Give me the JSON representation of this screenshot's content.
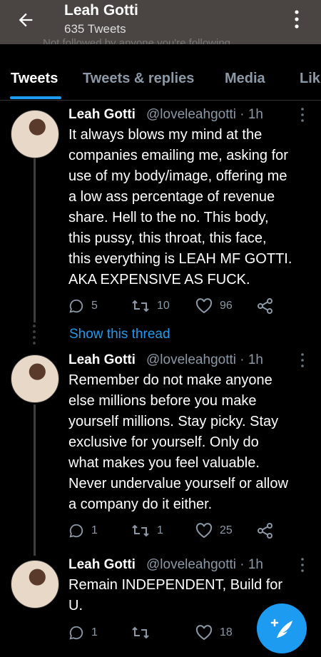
{
  "header": {
    "name": "Leah Gotti",
    "tweet_count": "635 Tweets",
    "obscured_text": "Not followed by anyone you're following"
  },
  "tabs": [
    "Tweets",
    "Tweets & replies",
    "Media",
    "Lik"
  ],
  "show_thread": "Show this thread",
  "tweets": [
    {
      "name": "Leah Gotti",
      "handle": "@loveleahgotti · 1h",
      "lines": [
        "It always blows my mind at the",
        "companies emailing me, asking for",
        "use of my body/image, offering me",
        "a low ass percentage of revenue",
        "share. Hell to the no. This body,",
        "this pussy, this throat, this face,",
        "this everything is LEAH MF GOTTI.",
        "AKA EXPENSIVE AS FUCK."
      ],
      "replies": "5",
      "retweets": "10",
      "likes": "96"
    },
    {
      "name": "Leah Gotti",
      "handle": "@loveleahgotti · 1h",
      "lines": [
        "Remember do not make anyone",
        "else millions before you make",
        "yourself millions. Stay picky. Stay",
        "exclusive for yourself.  Only do",
        "what makes you feel valuable.",
        "Never undervalue yourself or allow",
        "a company do it either."
      ],
      "replies": "1",
      "retweets": "1",
      "likes": "25"
    },
    {
      "name": "Leah Gotti",
      "handle": "@loveleahgotti · 1h",
      "lines": [
        "Remain INDEPENDENT, Build for",
        "U."
      ],
      "replies": "1",
      "retweets": "",
      "likes": "18"
    }
  ]
}
